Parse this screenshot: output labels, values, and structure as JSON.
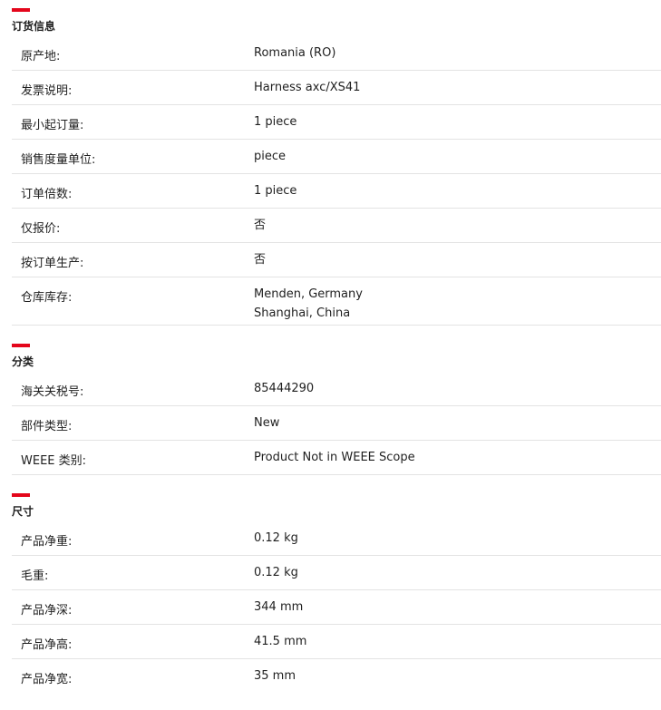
{
  "accent_color": "#e4061b",
  "sections": [
    {
      "title": "订货信息",
      "rows": [
        {
          "key": "原产地:",
          "value": "Romania (RO)"
        },
        {
          "key": "发票说明:",
          "value": "Harness axc/XS41"
        },
        {
          "key": "最小起订量:",
          "value": "1 piece"
        },
        {
          "key": "销售度量单位:",
          "value": "piece"
        },
        {
          "key": "订单倍数:",
          "value": "1 piece"
        },
        {
          "key": "仅报价:",
          "value": "否"
        },
        {
          "key": "按订单生产:",
          "value": "否"
        },
        {
          "key": "仓库库存:",
          "values": [
            "Menden, Germany",
            "Shanghai, China"
          ]
        }
      ]
    },
    {
      "title": "分类",
      "rows": [
        {
          "key": "海关关税号:",
          "value": "85444290"
        },
        {
          "key": "部件类型:",
          "value": "New"
        },
        {
          "key": "WEEE 类别:",
          "value": "Product Not in WEEE Scope"
        }
      ]
    },
    {
      "title": "尺寸",
      "rows": [
        {
          "key": "产品净重:",
          "value": "0.12 kg"
        },
        {
          "key": "毛重:",
          "value": "0.12 kg"
        },
        {
          "key": "产品净深:",
          "value": "344 mm"
        },
        {
          "key": "产品净高:",
          "value": "41.5 mm"
        },
        {
          "key": "产品净宽:",
          "value": "35 mm"
        }
      ]
    }
  ]
}
